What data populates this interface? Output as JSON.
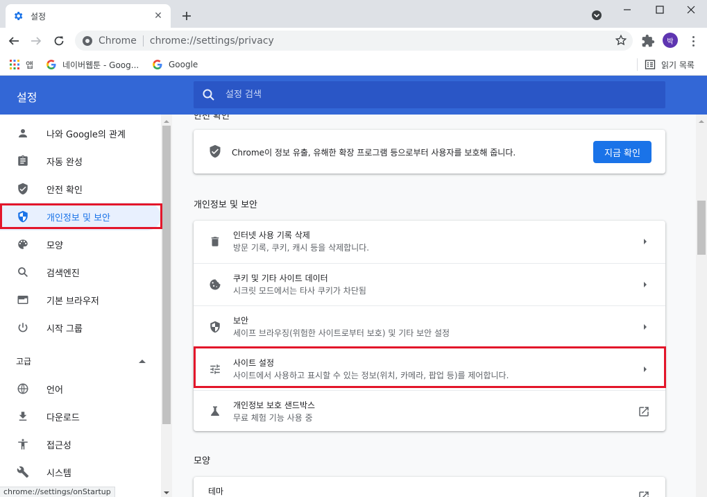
{
  "tab": {
    "title": "설정",
    "close": "✕"
  },
  "toolbar": {
    "origin": "Chrome",
    "url": "chrome://settings/privacy",
    "avatar_text": "박"
  },
  "bookmarks": {
    "items": [
      {
        "label": "앱"
      },
      {
        "label": "네이버웹툰 - Goog..."
      },
      {
        "label": "Google"
      }
    ],
    "reading_list": "읽기 목록"
  },
  "header": {
    "title": "설정",
    "search_placeholder": "설정 검색"
  },
  "sidebar": {
    "items": [
      {
        "label": "나와 Google의 관계"
      },
      {
        "label": "자동 완성"
      },
      {
        "label": "안전 확인"
      },
      {
        "label": "개인정보 및 보안"
      },
      {
        "label": "모양"
      },
      {
        "label": "검색엔진"
      },
      {
        "label": "기본 브라우저"
      },
      {
        "label": "시작 그룹"
      }
    ],
    "advanced_label": "고급",
    "advanced_items": [
      {
        "label": "언어"
      },
      {
        "label": "다운로드"
      },
      {
        "label": "접근성"
      },
      {
        "label": "시스템"
      }
    ]
  },
  "status_url": "chrome://settings/onStartup",
  "main": {
    "cutoff_heading": "안전 확인",
    "safety_check": {
      "text": "Chrome이 정보 유출, 유해한 확장 프로그램 등으로부터 사용자를 보호해 줍니다.",
      "button": "지금 확인"
    },
    "privacy_section_title": "개인정보 및 보안",
    "privacy_rows": [
      {
        "title": "인터넷 사용 기록 삭제",
        "subtitle": "방문 기록, 쿠키, 캐시 등을 삭제합니다."
      },
      {
        "title": "쿠키 및 기타 사이트 데이터",
        "subtitle": "시크릿 모드에서는 타사 쿠키가 차단됨"
      },
      {
        "title": "보안",
        "subtitle": "세이프 브라우징(위험한 사이트로부터 보호) 및 기타 보안 설정"
      },
      {
        "title": "사이트 설정",
        "subtitle": "사이트에서 사용하고 표시할 수 있는 정보(위치, 카메라, 팝업 등)를 제어합니다."
      },
      {
        "title": "개인정보 보호 샌드박스",
        "subtitle": "무료 체험 기능 사용 중"
      }
    ],
    "appearance_section_title": "모양",
    "appearance_rows": [
      {
        "title": "테마"
      }
    ]
  },
  "colors": {
    "accent": "#1a73e8",
    "header": "#3367d6",
    "highlight": "#e3162a"
  }
}
